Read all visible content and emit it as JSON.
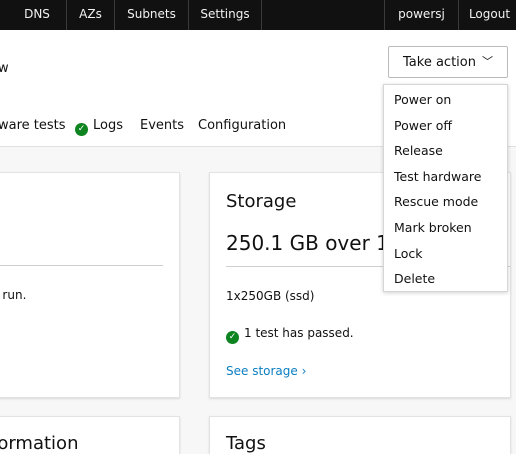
{
  "nav": {
    "items": [
      {
        "label": "DNS"
      },
      {
        "label": "AZs"
      },
      {
        "label": "Subnets"
      },
      {
        "label": "Settings"
      }
    ],
    "user": "powersj",
    "logout": "Logout"
  },
  "header": {
    "title_fragment": "w",
    "take_action_label": "Take action"
  },
  "tabs": [
    {
      "label": "ware tests"
    },
    {
      "label": "Logs"
    },
    {
      "label": "Events"
    },
    {
      "label": "Configuration"
    }
  ],
  "left_card": {
    "text": "n run."
  },
  "storage": {
    "title": "Storage",
    "size": "250.1 GB over 1",
    "disks": "1x250GB (ssd)",
    "test_status": "1 test has passed.",
    "link": "See storage ›"
  },
  "bottom": {
    "left_title": "formation",
    "tags_title": "Tags"
  },
  "dropdown": {
    "items": [
      {
        "label": "Power on"
      },
      {
        "label": "Power off"
      },
      {
        "label": "Release"
      },
      {
        "label": "Test hardware"
      },
      {
        "label": "Rescue mode"
      },
      {
        "label": "Mark broken"
      },
      {
        "label": "Lock"
      },
      {
        "label": "Delete"
      }
    ]
  },
  "colors": {
    "nav_bg": "#111111",
    "page_bg": "#f7f7f7",
    "success": "#0e8420",
    "link": "#0b7ec1"
  }
}
